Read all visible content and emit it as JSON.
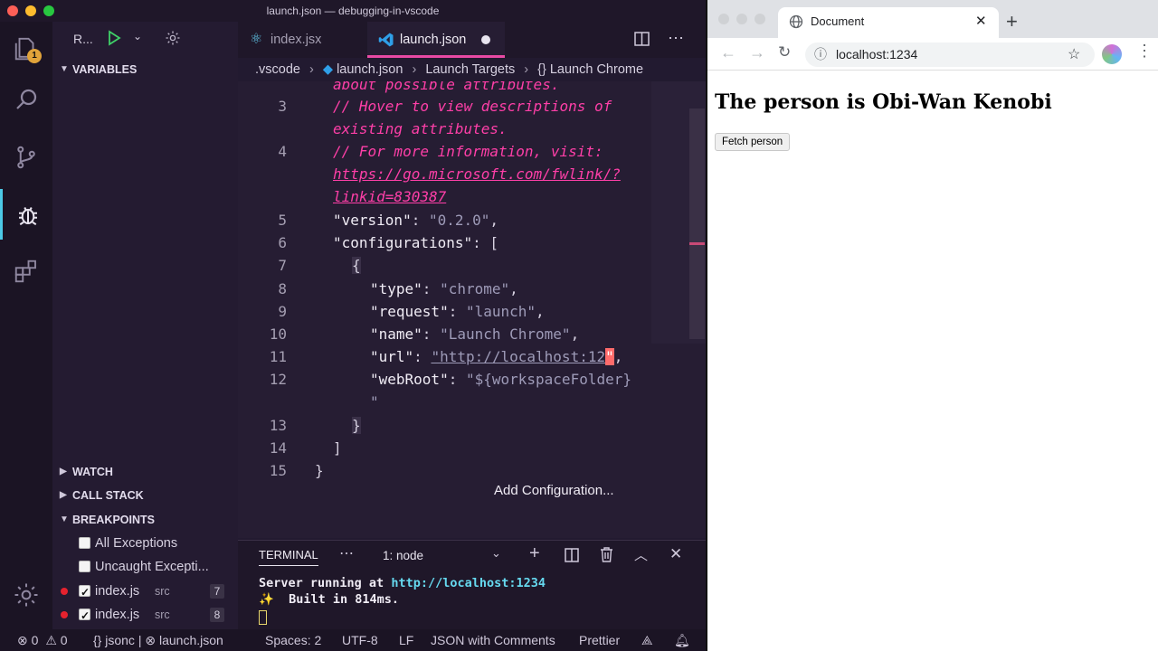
{
  "window": {
    "title": "launch.json — debugging-in-vscode"
  },
  "activity_bar": {
    "explorer_badge": "1"
  },
  "debug_toolbar": {
    "config_label": "R..."
  },
  "sidebar": {
    "variables": "VARIABLES",
    "watch": "WATCH",
    "call_stack": "CALL STACK",
    "breakpoints": "BREAKPOINTS",
    "breakpoint_items": [
      {
        "label": "All Exceptions",
        "checked": false
      },
      {
        "label": "Uncaught Excepti...",
        "checked": false
      },
      {
        "label": "index.js",
        "path": "src",
        "line": "7",
        "checked": true
      },
      {
        "label": "index.js",
        "path": "src",
        "line": "8",
        "checked": true
      }
    ]
  },
  "tabs": [
    {
      "label": "index.jsx",
      "active": false
    },
    {
      "label": "launch.json",
      "active": true,
      "modified": true
    }
  ],
  "breadcrumb": [
    ".vscode",
    "launch.json",
    "Launch Targets",
    "Launch Chrome"
  ],
  "editor": {
    "line_numbers": [
      "3",
      "4",
      "5",
      "6",
      "7",
      "8",
      "9",
      "10",
      "11",
      "12",
      "13",
      "14",
      "15"
    ],
    "lines": {
      "c0": "about possible attributes.",
      "c3": "// Hover to view descriptions of",
      "c3b": "existing attributes.",
      "c4": "// For more information, visit:",
      "c4b": "https://go.microsoft.com/fwlink/?",
      "c4c": "linkid=830387",
      "k5": "\"version\"",
      "v5": "\"0.2.0\"",
      "k6": "\"configurations\"",
      "k8": "\"type\"",
      "v8": "\"chrome\"",
      "k9": "\"request\"",
      "v9": "\"launch\"",
      "k10": "\"name\"",
      "v10": "\"Launch Chrome\"",
      "k11": "\"url\"",
      "v11": "\"http://localhost:12",
      "v11end": "\"",
      "k12": "\"webRoot\"",
      "v12": "\"${workspaceFolder}",
      "v12b": "\""
    },
    "add_configuration": "Add Configuration..."
  },
  "panel": {
    "tab": "TERMINAL",
    "terminal_select": "1: node",
    "output_line1_prefix": "Server running at ",
    "output_line1_link": "http://localhost:1234",
    "output_line2": "✨  Built in 814ms."
  },
  "status_bar": {
    "errors": "0",
    "warnings": "0",
    "language_mode_short": "jsonc",
    "file": "launch.json",
    "spaces": "Spaces: 2",
    "encoding": "UTF-8",
    "eol": "LF",
    "language": "JSON with Comments",
    "formatter": "Prettier"
  },
  "browser": {
    "tab_title": "Document",
    "url": "localhost:1234",
    "heading": "The person is Obi-Wan Kenobi",
    "fetch_button": "Fetch person"
  },
  "colors": {
    "accent": "#4cc9e6",
    "tab_underline": "#e84aa4",
    "comment": "#ff3fa8",
    "breakpoint": "#e5222e",
    "cursor": "#ff6b6b",
    "link": "#66d9ef"
  }
}
